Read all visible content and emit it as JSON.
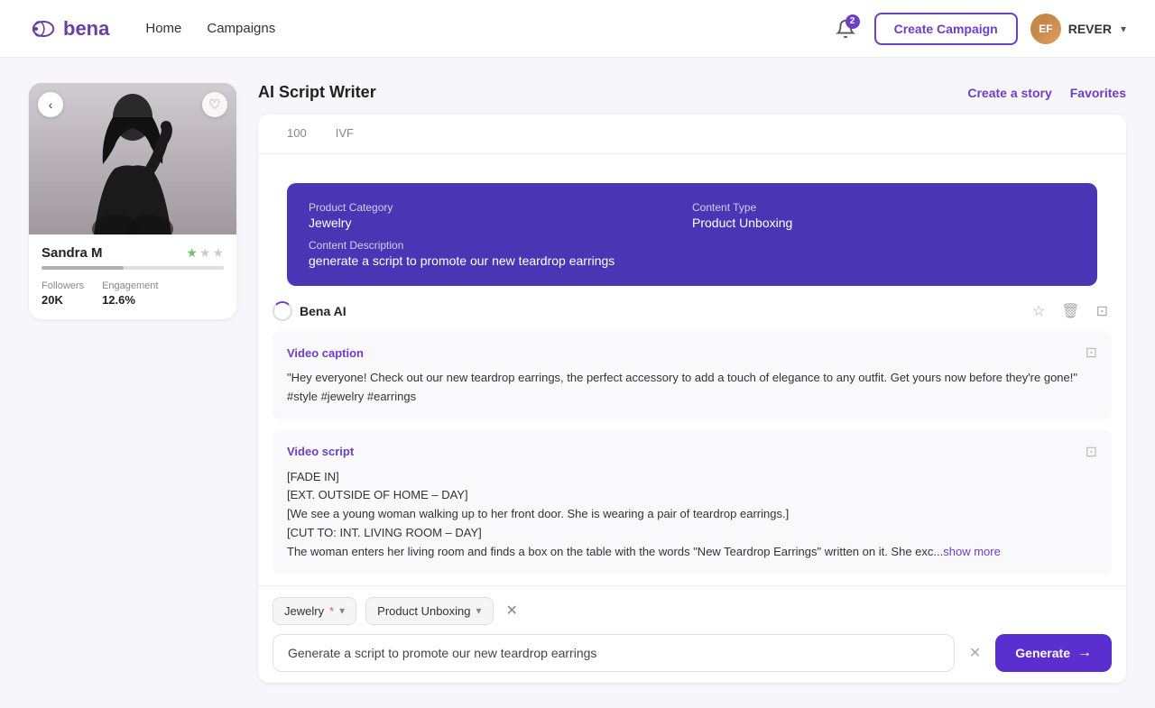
{
  "app": {
    "logo_text": "bena",
    "nav": {
      "home": "Home",
      "campaigns": "Campaigns"
    },
    "notification_count": "2",
    "create_btn": "Create Campaign",
    "user": {
      "name": "REVER",
      "initials": "EF"
    }
  },
  "profile": {
    "name": "Sandra M",
    "followers_label": "Followers",
    "followers_value": "20K",
    "engagement_label": "Engagement",
    "engagement_value": "12.6%"
  },
  "script_writer": {
    "title": "AI Script Writer",
    "create_story": "Create a story",
    "favorites": "Favorites",
    "tabs": [
      {
        "label": "100",
        "active": false
      },
      {
        "label": "IVF",
        "active": false
      }
    ],
    "info_card": {
      "product_category_label": "Product Category",
      "product_category_value": "Jewelry",
      "content_type_label": "Content Type",
      "content_type_value": "Product Unboxing",
      "content_description_label": "Content Description",
      "content_description_value": "generate a script to promote our new teardrop earrings"
    },
    "ai_name": "Bena AI",
    "video_caption": {
      "title": "Video caption",
      "text": "\"Hey everyone! Check out our new teardrop earrings, the perfect accessory to add a touch of elegance to any outfit. Get yours now before they're gone!\" #style #jewelry #earrings"
    },
    "video_script": {
      "title": "Video script",
      "lines": [
        "[FADE IN]",
        "[EXT. OUTSIDE OF HOME – DAY]",
        "[We see a young woman walking up to her front door. She is wearing a pair of teardrop earrings.]",
        "[CUT TO: INT. LIVING ROOM – DAY]",
        "The woman enters her living room and finds a box on the table with the words \"New Teardrop Earrings\" written on it. She exc..."
      ],
      "show_more": "show more"
    },
    "input": {
      "category_label": "Jewelry",
      "category_required": "*",
      "content_type_label": "Product Unboxing",
      "placeholder": "Generate a script to promote our new teardrop earrings",
      "generate_btn": "Generate"
    }
  }
}
